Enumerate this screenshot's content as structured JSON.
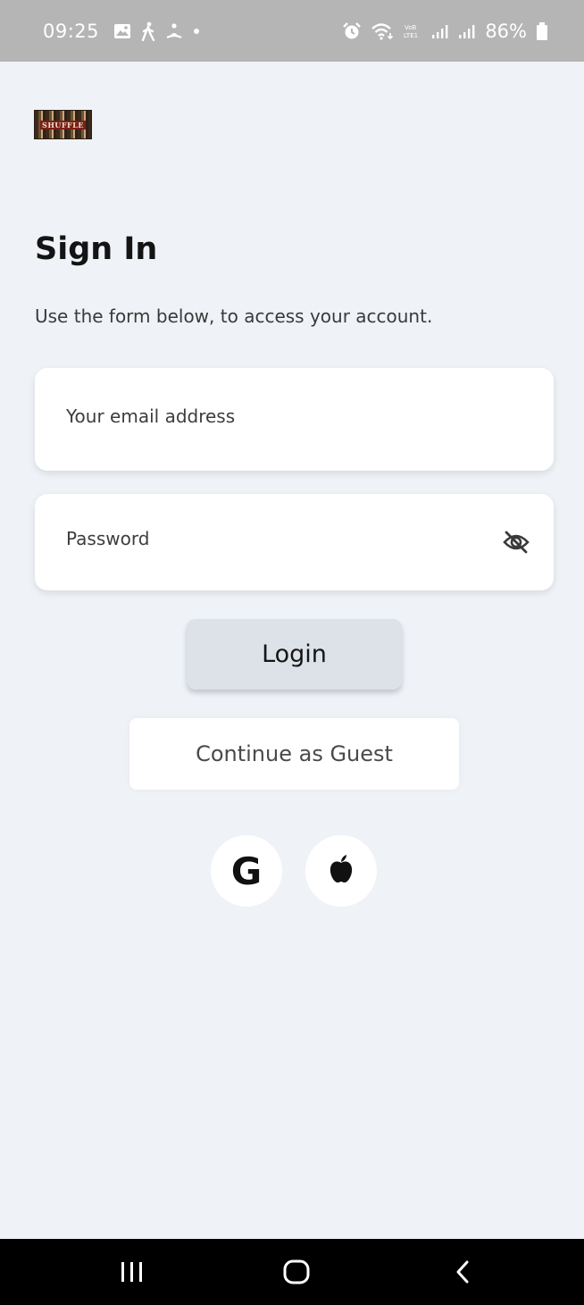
{
  "status_bar": {
    "time": "09:25",
    "battery": "86%",
    "icons": [
      "gallery-icon",
      "walking-icon",
      "meditation-icon",
      "dot-icon",
      "alarm-icon",
      "wifi-icon",
      "volte-icon",
      "signal-icon",
      "signal-icon",
      "battery-icon"
    ],
    "volte_label": "VoLTE"
  },
  "logo": {
    "text": "SHUFFLE",
    "icon": "app-logo"
  },
  "header": {
    "title": "Sign In",
    "subtitle": "Use the form below, to access your account."
  },
  "form": {
    "email_placeholder": "Your email address",
    "email_value": "",
    "password_placeholder": "Password",
    "password_value": "",
    "password_toggle_icon": "eye-off-icon"
  },
  "actions": {
    "login_label": "Login",
    "guest_label": "Continue as Guest"
  },
  "social": {
    "google_label": "G",
    "google_icon": "google-icon",
    "apple_icon": "apple-icon"
  },
  "navigation": {
    "items": [
      "recents-icon",
      "home-icon",
      "back-icon"
    ]
  },
  "colors": {
    "background": "#eff2f7",
    "status_bar": "#b5b5b5",
    "login_button": "#dde1e8",
    "nav_bar": "#000000"
  }
}
